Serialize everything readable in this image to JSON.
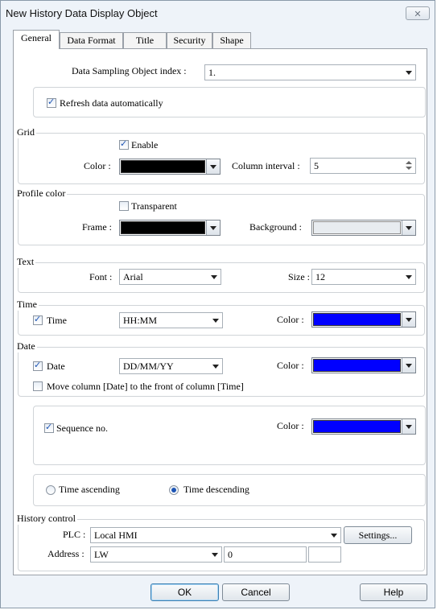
{
  "window": {
    "title": "New History Data Display Object",
    "close_icon": "✕"
  },
  "tabs": [
    "General",
    "Data Format",
    "Title",
    "Security",
    "Shape"
  ],
  "sampling": {
    "label": "Data Sampling Object index :",
    "value": "1."
  },
  "refresh": {
    "label": "Refresh data automatically",
    "checked": true
  },
  "grid": {
    "group": "Grid",
    "enable_label": "Enable",
    "enable_checked": true,
    "color_label": "Color :",
    "color": "#000000",
    "column_interval_label": "Column interval :",
    "column_interval": "5"
  },
  "profile": {
    "group": "Profile color",
    "transparent_label": "Transparent",
    "transparent_checked": false,
    "frame_label": "Frame :",
    "frame_color": "#000000",
    "background_label": "Background :",
    "background_color": "#e8ecf0"
  },
  "text": {
    "group": "Text",
    "font_label": "Font :",
    "font": "Arial",
    "size_label": "Size :",
    "size": "12"
  },
  "time": {
    "group": "Time",
    "check_label": "Time",
    "checked": true,
    "format": "HH:MM",
    "color_label": "Color :",
    "color": "#0000ff"
  },
  "date": {
    "group": "Date",
    "check_label": "Date",
    "checked": true,
    "format": "DD/MM/YY",
    "color_label": "Color :",
    "color": "#0000ff",
    "move_label": "Move column [Date] to the front of column [Time]",
    "move_checked": false
  },
  "sequence": {
    "check_label": "Sequence no.",
    "checked": true,
    "color_label": "Color :",
    "color": "#0000ff"
  },
  "order": {
    "ascending_label": "Time ascending",
    "descending_label": "Time descending",
    "selected": "descending"
  },
  "history": {
    "group": "History control",
    "plc_label": "PLC :",
    "plc": "Local HMI",
    "settings_label": "Settings...",
    "address_label": "Address :",
    "address_type": "LW",
    "address_value": "0"
  },
  "footer": {
    "ok": "OK",
    "cancel": "Cancel",
    "help": "Help"
  }
}
